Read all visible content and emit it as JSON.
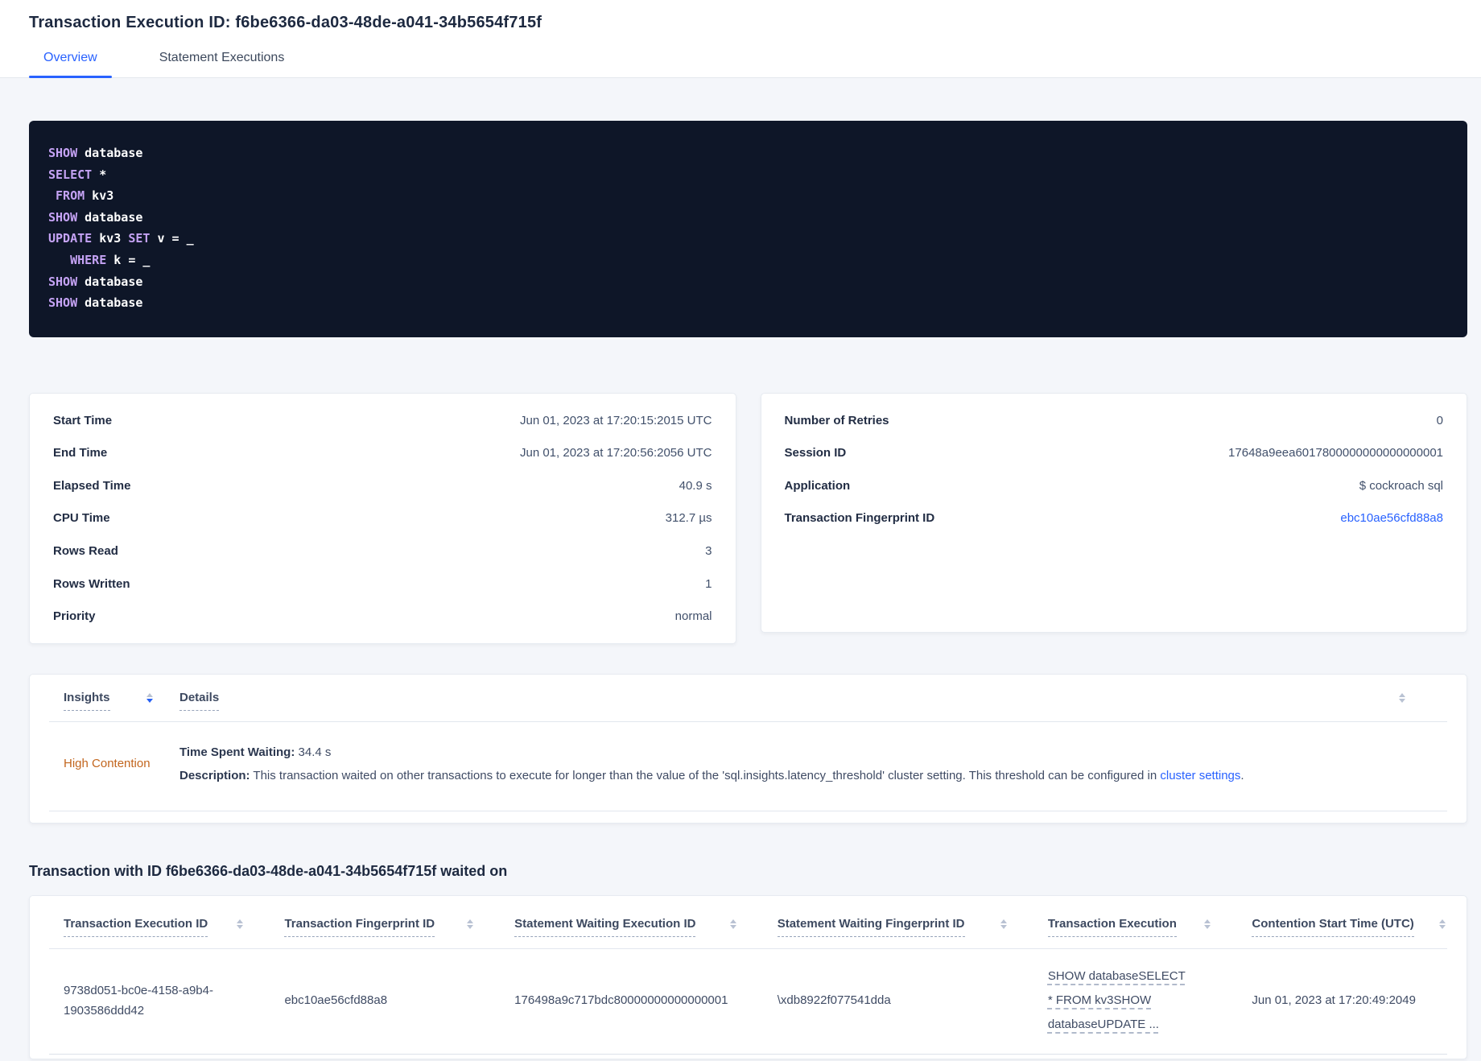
{
  "page": {
    "title": "Transaction Execution ID: f6be6366-da03-48de-a041-34b5654f715f",
    "tabs": [
      {
        "label": "Overview",
        "active": true
      },
      {
        "label": "Statement Executions",
        "active": false
      }
    ]
  },
  "colors": {
    "accent_blue": "#2962ff",
    "insight_warning_orange": "#c2651d",
    "code_background": "#0e1628",
    "code_keyword_purple": "#c5a3f5"
  },
  "sql": {
    "lines": [
      {
        "segments": [
          {
            "type": "keyword",
            "text": "SHOW"
          },
          {
            "type": "plain",
            "text": " database"
          }
        ]
      },
      {
        "segments": [
          {
            "type": "keyword",
            "text": "SELECT"
          },
          {
            "type": "plain",
            "text": " *"
          }
        ]
      },
      {
        "segments": [
          {
            "type": "plain",
            "text": " "
          },
          {
            "type": "keyword",
            "text": "FROM"
          },
          {
            "type": "plain",
            "text": " kv3"
          }
        ]
      },
      {
        "segments": [
          {
            "type": "keyword",
            "text": "SHOW"
          },
          {
            "type": "plain",
            "text": " database"
          }
        ]
      },
      {
        "segments": [
          {
            "type": "keyword",
            "text": "UPDATE"
          },
          {
            "type": "plain",
            "text": " kv3 "
          },
          {
            "type": "keyword",
            "text": "SET"
          },
          {
            "type": "plain",
            "text": " v = _"
          }
        ]
      },
      {
        "segments": [
          {
            "type": "plain",
            "text": "   "
          },
          {
            "type": "keyword",
            "text": "WHERE"
          },
          {
            "type": "plain",
            "text": " k = _"
          }
        ]
      },
      {
        "segments": [
          {
            "type": "keyword",
            "text": "SHOW"
          },
          {
            "type": "plain",
            "text": " database"
          }
        ]
      },
      {
        "segments": [
          {
            "type": "keyword",
            "text": "SHOW"
          },
          {
            "type": "plain",
            "text": " database"
          }
        ]
      }
    ]
  },
  "summary_left": {
    "rows": [
      {
        "label": "Start Time",
        "value": "Jun 01, 2023 at 17:20:15:2015 UTC"
      },
      {
        "label": "End Time",
        "value": "Jun 01, 2023 at 17:20:56:2056 UTC"
      },
      {
        "label": "Elapsed Time",
        "value": "40.9 s"
      },
      {
        "label": "CPU Time",
        "value": "312.7 µs"
      },
      {
        "label": "Rows Read",
        "value": "3"
      },
      {
        "label": "Rows Written",
        "value": "1"
      },
      {
        "label": "Priority",
        "value": "normal"
      }
    ]
  },
  "summary_right": {
    "rows": [
      {
        "label": "Number of Retries",
        "value": "0"
      },
      {
        "label": "Session ID",
        "value": "17648a9eea6017800000000000000001"
      },
      {
        "label": "Application",
        "value": "$ cockroach sql"
      },
      {
        "label": "Transaction Fingerprint ID",
        "value": "ebc10ae56cfd88a8",
        "is_link": true
      }
    ]
  },
  "insights": {
    "columns": [
      {
        "label": "Insights"
      },
      {
        "label": "Details"
      }
    ],
    "row": {
      "insight": "High Contention",
      "waiting_label": "Time Spent Waiting:",
      "waiting_value": " 34.4 s",
      "description_label": "Description:",
      "description_text": " This transaction waited on other transactions to execute for longer than the value of the 'sql.insights.latency_threshold' cluster setting. This threshold can be configured in ",
      "description_link": "cluster settings",
      "description_period": "."
    }
  },
  "waited_on": {
    "heading": "Transaction with ID f6be6366-da03-48de-a041-34b5654f715f waited on",
    "columns": [
      {
        "label": "Transaction Execution ID"
      },
      {
        "label": "Transaction Fingerprint ID"
      },
      {
        "label": "Statement Waiting Execution ID"
      },
      {
        "label": "Statement Waiting Fingerprint ID"
      },
      {
        "label": "Transaction Execution"
      },
      {
        "label": "Contention Start Time (UTC)"
      }
    ],
    "rows": [
      {
        "transaction_execution_id": "9738d051-bc0e-4158-a9b4-1903586ddd42",
        "transaction_fingerprint_id": "ebc10ae56cfd88a8",
        "statement_waiting_execution_id": "176498a9c717bdc80000000000000001",
        "statement_waiting_fingerprint_id": "\\xdb8922f077541dda",
        "transaction_execution": "SHOW databaseSELECT * FROM kv3SHOW databaseUPDATE ...",
        "contention_start_time": "Jun 01, 2023 at 17:20:49:2049"
      }
    ]
  }
}
